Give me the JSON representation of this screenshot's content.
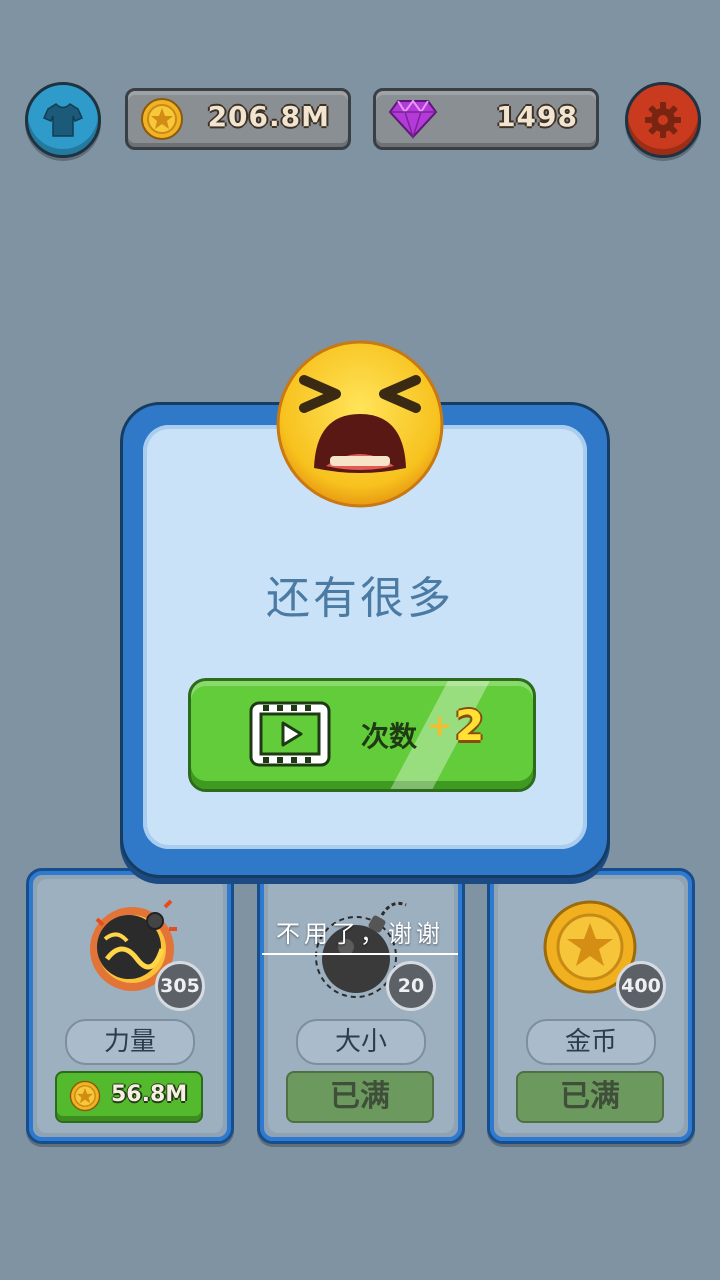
{
  "top_bar": {
    "coins": "206.8M",
    "gems": "1498",
    "icons": [
      "shirt-icon",
      "coin-icon",
      "gem-icon",
      "gear-icon"
    ]
  },
  "dialog": {
    "face": "crying-face-icon",
    "title": "还有很多",
    "video_button": {
      "label": "次数",
      "plus": "+",
      "amount": "2"
    }
  },
  "decline_link": "不用了，谢谢",
  "cards": [
    {
      "name": "力量",
      "level": "305",
      "price": "56.8M",
      "status": ""
    },
    {
      "name": "大小",
      "level": "20",
      "price": "",
      "status": "已满"
    },
    {
      "name": "金币",
      "level": "400",
      "price": "",
      "status": "已满"
    }
  ],
  "colors": {
    "background": "#7f93a3",
    "dialog_frame": "#2f79c8",
    "button_green": "#62cc3a",
    "shirt_button": "#2e9bcb",
    "settings_button": "#c93a1e"
  }
}
